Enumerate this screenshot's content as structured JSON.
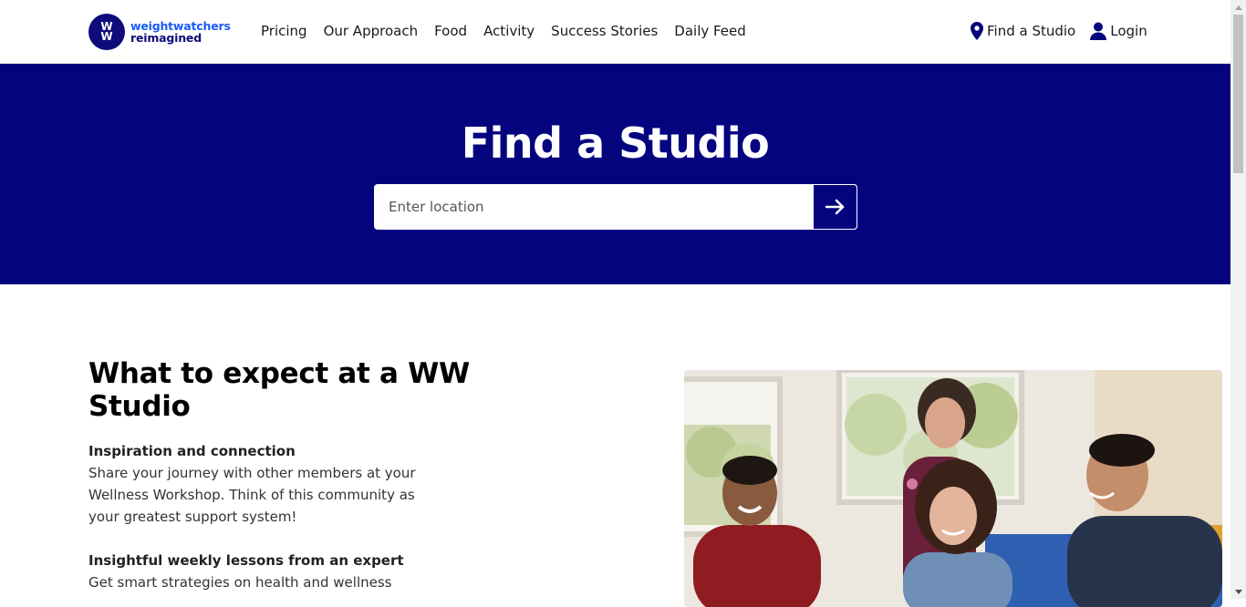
{
  "header": {
    "logo": {
      "mark_top": "W",
      "mark_bottom": "W",
      "line1": "weightwatchers",
      "line2": "reimagined"
    },
    "nav": [
      "Pricing",
      "Our Approach",
      "Food",
      "Activity",
      "Success Stories",
      "Daily Feed"
    ],
    "find_studio": "Find a Studio",
    "login": "Login"
  },
  "hero": {
    "title": "Find a Studio",
    "search_placeholder": "Enter location",
    "background_color": "#04047f"
  },
  "content": {
    "title": "What to expect at a WW Studio",
    "features": [
      {
        "title": "Inspiration and connection",
        "description": "Share your journey with other members at your Wellness Workshop. Think of this community as your greatest support system!"
      },
      {
        "title": "Insightful weekly lessons from an expert",
        "description": "Get smart strategies on health and wellness"
      }
    ]
  },
  "colors": {
    "brand_navy": "#04047f",
    "brand_blue": "#1b5cf5"
  }
}
